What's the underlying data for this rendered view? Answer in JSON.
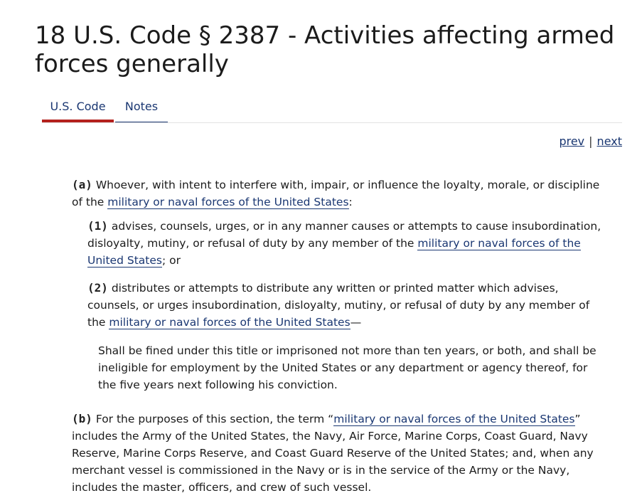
{
  "title": "18 U.S. Code § 2387 - Activities affecting armed forces generally",
  "tabs": {
    "code": "U.S. Code",
    "notes": "Notes"
  },
  "pager": {
    "prev": "prev",
    "separator": "|",
    "next": "next"
  },
  "section": {
    "a": {
      "num": "(a)",
      "text_before": " Whoever, with intent to interfere with, impair, or influence the loyalty, morale, or discipline of the ",
      "link": "military or naval forces of the United States",
      "text_after": ":"
    },
    "p1": {
      "num": "(1)",
      "text_before": " advises, counsels, urges, or in any manner causes or attempts to cause insubordination, disloyalty, mutiny, or refusal of duty by any member of the ",
      "link": "military or naval forces of the United States",
      "text_after": "; or"
    },
    "p2": {
      "num": "(2)",
      "text_before": " distributes or attempts to distribute any written or printed matter which advises, counsels, or urges insubordination, disloyalty, mutiny, or refusal of duty by any member of the ",
      "link": "military or naval forces of the United States",
      "text_after": "—"
    },
    "continuation": "Shall be fined under this title or imprisoned not more than ten years, or both, and shall be ineligible for employment by the United States or any department or agency thereof, for the five years next following his conviction.",
    "b": {
      "num": "(b)",
      "text_before": " For the purposes of this section, the term “",
      "link": "military or naval forces of the United States",
      "text_after": "” includes the Army of the United States, the Navy, Air Force, Marine Corps, Coast Guard, Navy Reserve, Marine Corps Reserve, and Coast Guard Reserve of the United States; and, when any merchant vessel is commissioned in the Navy or is in the service of the Army or the Navy, includes the master, officers, and crew of such vessel."
    }
  },
  "colors": {
    "link": "#1a3772",
    "active_tab_underline": "#b4211d",
    "text": "#1b1b1b"
  }
}
